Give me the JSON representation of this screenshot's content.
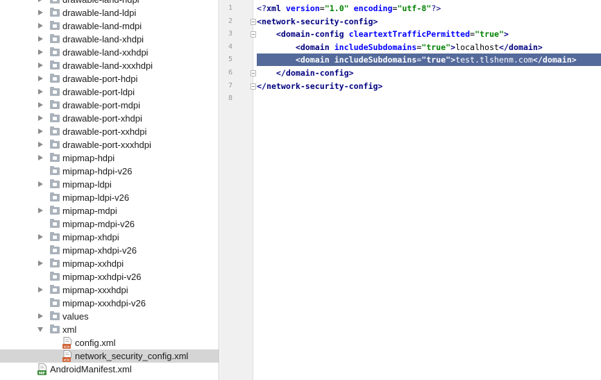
{
  "project_tree": {
    "rows": [
      {
        "label": "drawable-land-hdpi",
        "type": "folder",
        "expanded": false
      },
      {
        "label": "drawable-land-ldpi",
        "type": "folder",
        "expanded": false
      },
      {
        "label": "drawable-land-mdpi",
        "type": "folder",
        "expanded": false
      },
      {
        "label": "drawable-land-xhdpi",
        "type": "folder",
        "expanded": false
      },
      {
        "label": "drawable-land-xxhdpi",
        "type": "folder",
        "expanded": false
      },
      {
        "label": "drawable-land-xxxhdpi",
        "type": "folder",
        "expanded": false
      },
      {
        "label": "drawable-port-hdpi",
        "type": "folder",
        "expanded": false
      },
      {
        "label": "drawable-port-ldpi",
        "type": "folder",
        "expanded": false
      },
      {
        "label": "drawable-port-mdpi",
        "type": "folder",
        "expanded": false
      },
      {
        "label": "drawable-port-xhdpi",
        "type": "folder",
        "expanded": false
      },
      {
        "label": "drawable-port-xxhdpi",
        "type": "folder",
        "expanded": false
      },
      {
        "label": "drawable-port-xxxhdpi",
        "type": "folder",
        "expanded": false
      },
      {
        "label": "mipmap-hdpi",
        "type": "folder",
        "expanded": false
      },
      {
        "label": "mipmap-hdpi-v26",
        "type": "folder-noarrow"
      },
      {
        "label": "mipmap-ldpi",
        "type": "folder",
        "expanded": false
      },
      {
        "label": "mipmap-ldpi-v26",
        "type": "folder-noarrow"
      },
      {
        "label": "mipmap-mdpi",
        "type": "folder",
        "expanded": false
      },
      {
        "label": "mipmap-mdpi-v26",
        "type": "folder-noarrow"
      },
      {
        "label": "mipmap-xhdpi",
        "type": "folder",
        "expanded": false
      },
      {
        "label": "mipmap-xhdpi-v26",
        "type": "folder-noarrow"
      },
      {
        "label": "mipmap-xxhdpi",
        "type": "folder",
        "expanded": false
      },
      {
        "label": "mipmap-xxhdpi-v26",
        "type": "folder-noarrow"
      },
      {
        "label": "mipmap-xxxhdpi",
        "type": "folder",
        "expanded": false
      },
      {
        "label": "mipmap-xxxhdpi-v26",
        "type": "folder-noarrow"
      },
      {
        "label": "values",
        "type": "folder",
        "expanded": false
      },
      {
        "label": "xml",
        "type": "folder",
        "expanded": true
      },
      {
        "label": "config.xml",
        "type": "xml-file"
      },
      {
        "label": "network_security_config.xml",
        "type": "xml-file",
        "selected": true
      },
      {
        "label": "AndroidManifest.xml",
        "type": "manifest-file"
      }
    ]
  },
  "editor": {
    "line_numbers": [
      "1",
      "2",
      "3",
      "4",
      "5",
      "6",
      "7",
      "8"
    ],
    "lines": [
      {
        "tokens": [
          [
            "pi",
            "<?"
          ],
          [
            "tag",
            "xml "
          ],
          [
            "attr",
            "version"
          ],
          [
            "plain",
            "="
          ],
          [
            "val",
            "\"1.0\""
          ],
          [
            "plain",
            " "
          ],
          [
            "attr",
            "encoding"
          ],
          [
            "plain",
            "="
          ],
          [
            "val",
            "\"utf-8\""
          ],
          [
            "pi",
            "?>"
          ]
        ]
      },
      {
        "tokens": [
          [
            "tag",
            "<network-security-config>"
          ]
        ]
      },
      {
        "tokens": [
          [
            "plain",
            "    "
          ],
          [
            "tag",
            "<domain-config "
          ],
          [
            "attr",
            "cleartextTrafficPermitted"
          ],
          [
            "plain",
            "="
          ],
          [
            "val",
            "\"true\""
          ],
          [
            "tag",
            ">"
          ]
        ]
      },
      {
        "tokens": [
          [
            "plain",
            "        "
          ],
          [
            "tag",
            "<domain "
          ],
          [
            "attr",
            "includeSubdomains"
          ],
          [
            "plain",
            "="
          ],
          [
            "val",
            "\"true\""
          ],
          [
            "tag",
            ">"
          ],
          [
            "plain",
            "localhost"
          ],
          [
            "tag",
            "</domain>"
          ]
        ]
      },
      {
        "tokens": [
          [
            "plain",
            "        "
          ],
          [
            "tag",
            "<domain "
          ],
          [
            "attr",
            "includeSubdomains"
          ],
          [
            "plain",
            "="
          ],
          [
            "val",
            "\"true\""
          ],
          [
            "tag",
            ">"
          ],
          [
            "plain",
            "test.tlshenm.com"
          ],
          [
            "tag",
            "</domain>"
          ]
        ],
        "selected": true
      },
      {
        "tokens": [
          [
            "plain",
            "    "
          ],
          [
            "tag",
            "</domain-config>"
          ]
        ]
      },
      {
        "tokens": [
          [
            "tag",
            "</network-security-config>"
          ]
        ]
      },
      {
        "tokens": []
      }
    ]
  },
  "icons": {
    "folder": "folder-icon",
    "xml_file": "xml-file-icon",
    "manifest_file": "manifest-file-icon",
    "expand_arrow": "chevron-right-icon",
    "collapse_arrow": "chevron-down-icon",
    "manifest_badge": "MF",
    "xml_badge": "<>"
  },
  "colors": {
    "selection": "#546a9b",
    "tree_selected": "#d5d5d5",
    "tag": "#000080",
    "attr": "#0000ff",
    "value": "#008000"
  }
}
